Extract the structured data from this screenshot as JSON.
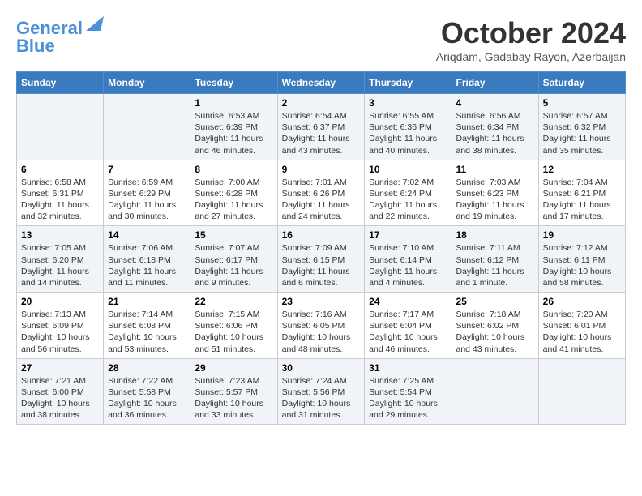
{
  "logo": {
    "line1": "General",
    "line2": "Blue"
  },
  "title": "October 2024",
  "location": "Ariqdam, Gadabay Rayon, Azerbaijan",
  "days_header": [
    "Sunday",
    "Monday",
    "Tuesday",
    "Wednesday",
    "Thursday",
    "Friday",
    "Saturday"
  ],
  "weeks": [
    [
      {
        "day": "",
        "info": ""
      },
      {
        "day": "",
        "info": ""
      },
      {
        "day": "1",
        "sunrise": "6:53 AM",
        "sunset": "6:39 PM",
        "daylight": "11 hours and 46 minutes."
      },
      {
        "day": "2",
        "sunrise": "6:54 AM",
        "sunset": "6:37 PM",
        "daylight": "11 hours and 43 minutes."
      },
      {
        "day": "3",
        "sunrise": "6:55 AM",
        "sunset": "6:36 PM",
        "daylight": "11 hours and 40 minutes."
      },
      {
        "day": "4",
        "sunrise": "6:56 AM",
        "sunset": "6:34 PM",
        "daylight": "11 hours and 38 minutes."
      },
      {
        "day": "5",
        "sunrise": "6:57 AM",
        "sunset": "6:32 PM",
        "daylight": "11 hours and 35 minutes."
      }
    ],
    [
      {
        "day": "6",
        "sunrise": "6:58 AM",
        "sunset": "6:31 PM",
        "daylight": "11 hours and 32 minutes."
      },
      {
        "day": "7",
        "sunrise": "6:59 AM",
        "sunset": "6:29 PM",
        "daylight": "11 hours and 30 minutes."
      },
      {
        "day": "8",
        "sunrise": "7:00 AM",
        "sunset": "6:28 PM",
        "daylight": "11 hours and 27 minutes."
      },
      {
        "day": "9",
        "sunrise": "7:01 AM",
        "sunset": "6:26 PM",
        "daylight": "11 hours and 24 minutes."
      },
      {
        "day": "10",
        "sunrise": "7:02 AM",
        "sunset": "6:24 PM",
        "daylight": "11 hours and 22 minutes."
      },
      {
        "day": "11",
        "sunrise": "7:03 AM",
        "sunset": "6:23 PM",
        "daylight": "11 hours and 19 minutes."
      },
      {
        "day": "12",
        "sunrise": "7:04 AM",
        "sunset": "6:21 PM",
        "daylight": "11 hours and 17 minutes."
      }
    ],
    [
      {
        "day": "13",
        "sunrise": "7:05 AM",
        "sunset": "6:20 PM",
        "daylight": "11 hours and 14 minutes."
      },
      {
        "day": "14",
        "sunrise": "7:06 AM",
        "sunset": "6:18 PM",
        "daylight": "11 hours and 11 minutes."
      },
      {
        "day": "15",
        "sunrise": "7:07 AM",
        "sunset": "6:17 PM",
        "daylight": "11 hours and 9 minutes."
      },
      {
        "day": "16",
        "sunrise": "7:09 AM",
        "sunset": "6:15 PM",
        "daylight": "11 hours and 6 minutes."
      },
      {
        "day": "17",
        "sunrise": "7:10 AM",
        "sunset": "6:14 PM",
        "daylight": "11 hours and 4 minutes."
      },
      {
        "day": "18",
        "sunrise": "7:11 AM",
        "sunset": "6:12 PM",
        "daylight": "11 hours and 1 minute."
      },
      {
        "day": "19",
        "sunrise": "7:12 AM",
        "sunset": "6:11 PM",
        "daylight": "10 hours and 58 minutes."
      }
    ],
    [
      {
        "day": "20",
        "sunrise": "7:13 AM",
        "sunset": "6:09 PM",
        "daylight": "10 hours and 56 minutes."
      },
      {
        "day": "21",
        "sunrise": "7:14 AM",
        "sunset": "6:08 PM",
        "daylight": "10 hours and 53 minutes."
      },
      {
        "day": "22",
        "sunrise": "7:15 AM",
        "sunset": "6:06 PM",
        "daylight": "10 hours and 51 minutes."
      },
      {
        "day": "23",
        "sunrise": "7:16 AM",
        "sunset": "6:05 PM",
        "daylight": "10 hours and 48 minutes."
      },
      {
        "day": "24",
        "sunrise": "7:17 AM",
        "sunset": "6:04 PM",
        "daylight": "10 hours and 46 minutes."
      },
      {
        "day": "25",
        "sunrise": "7:18 AM",
        "sunset": "6:02 PM",
        "daylight": "10 hours and 43 minutes."
      },
      {
        "day": "26",
        "sunrise": "7:20 AM",
        "sunset": "6:01 PM",
        "daylight": "10 hours and 41 minutes."
      }
    ],
    [
      {
        "day": "27",
        "sunrise": "7:21 AM",
        "sunset": "6:00 PM",
        "daylight": "10 hours and 38 minutes."
      },
      {
        "day": "28",
        "sunrise": "7:22 AM",
        "sunset": "5:58 PM",
        "daylight": "10 hours and 36 minutes."
      },
      {
        "day": "29",
        "sunrise": "7:23 AM",
        "sunset": "5:57 PM",
        "daylight": "10 hours and 33 minutes."
      },
      {
        "day": "30",
        "sunrise": "7:24 AM",
        "sunset": "5:56 PM",
        "daylight": "10 hours and 31 minutes."
      },
      {
        "day": "31",
        "sunrise": "7:25 AM",
        "sunset": "5:54 PM",
        "daylight": "10 hours and 29 minutes."
      },
      {
        "day": "",
        "info": ""
      },
      {
        "day": "",
        "info": ""
      }
    ]
  ]
}
